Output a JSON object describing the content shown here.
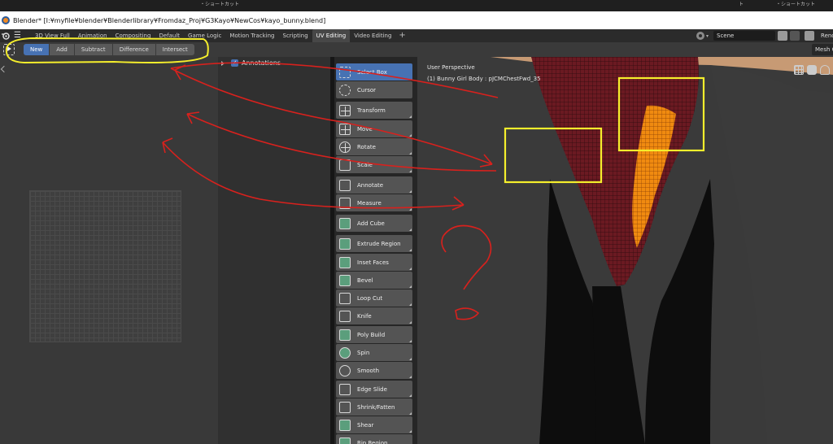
{
  "top_strip": {
    "left_text": "・ショートカット",
    "mid_text": "ト",
    "right_text": "・ショートカット"
  },
  "window": {
    "title": "Blender* [I:¥myfile¥blender¥Blenderlibrary¥Fromdaz_Proj¥G3Kayo¥NewCos¥kayo_bunny.blend]"
  },
  "workspace_tabs": [
    {
      "label": "3D View Full"
    },
    {
      "label": "Animation"
    },
    {
      "label": "Compositing"
    },
    {
      "label": "Default"
    },
    {
      "label": "Game Logic"
    },
    {
      "label": "Motion Tracking"
    },
    {
      "label": "Scripting"
    },
    {
      "label": "UV Editing",
      "active": true
    },
    {
      "label": "Video Editing"
    }
  ],
  "add_tab_label": "+",
  "scene": {
    "value": "Scene",
    "render_label": "Rende"
  },
  "select_modes": [
    {
      "label": "New",
      "active": true
    },
    {
      "label": "Add"
    },
    {
      "label": "Subtract"
    },
    {
      "label": "Difference"
    },
    {
      "label": "Intersect"
    }
  ],
  "mesh_menu_label": "Mesh C",
  "annotations": {
    "label": "Annotations",
    "checked": true
  },
  "tools": [
    {
      "label": "Select Box",
      "icon": "select-box-icon",
      "active": true
    },
    {
      "label": "Cursor",
      "icon": "cursor-icon"
    },
    {
      "label": "Transform",
      "icon": "transform-icon"
    },
    {
      "label": "Move",
      "icon": "move-icon"
    },
    {
      "label": "Rotate",
      "icon": "rotate-icon"
    },
    {
      "label": "Scale",
      "icon": "scale-icon"
    },
    {
      "label": "Annotate",
      "icon": "annotate-icon"
    },
    {
      "label": "Measure",
      "icon": "measure-icon"
    },
    {
      "label": "Add Cube",
      "icon": "add-cube-icon"
    },
    {
      "label": "Extrude Region",
      "icon": "extrude-region-icon"
    },
    {
      "label": "Inset Faces",
      "icon": "inset-faces-icon"
    },
    {
      "label": "Bevel",
      "icon": "bevel-icon"
    },
    {
      "label": "Loop Cut",
      "icon": "loop-cut-icon"
    },
    {
      "label": "Knife",
      "icon": "knife-icon"
    },
    {
      "label": "Poly Build",
      "icon": "poly-build-icon"
    },
    {
      "label": "Spin",
      "icon": "spin-icon"
    },
    {
      "label": "Smooth",
      "icon": "smooth-icon"
    },
    {
      "label": "Edge Slide",
      "icon": "edge-slide-icon"
    },
    {
      "label": "Shrink/Fatten",
      "icon": "shrink-fatten-icon"
    },
    {
      "label": "Shear",
      "icon": "shear-icon"
    },
    {
      "label": "Rip Region",
      "icon": "rip-region-icon"
    }
  ],
  "viewport": {
    "perspective_label": "User Perspective",
    "object_label": "(1) Bunny Girl Body : pJCMChestFwd_35"
  },
  "colors": {
    "accent_blue": "#4772b3",
    "annotation_yellow": "#f5ee2c",
    "annotation_red": "#d8211d",
    "mesh_dark_red": "#6b1a22",
    "mesh_selected_orange": "#f08a10",
    "skin": "#c79a74"
  }
}
